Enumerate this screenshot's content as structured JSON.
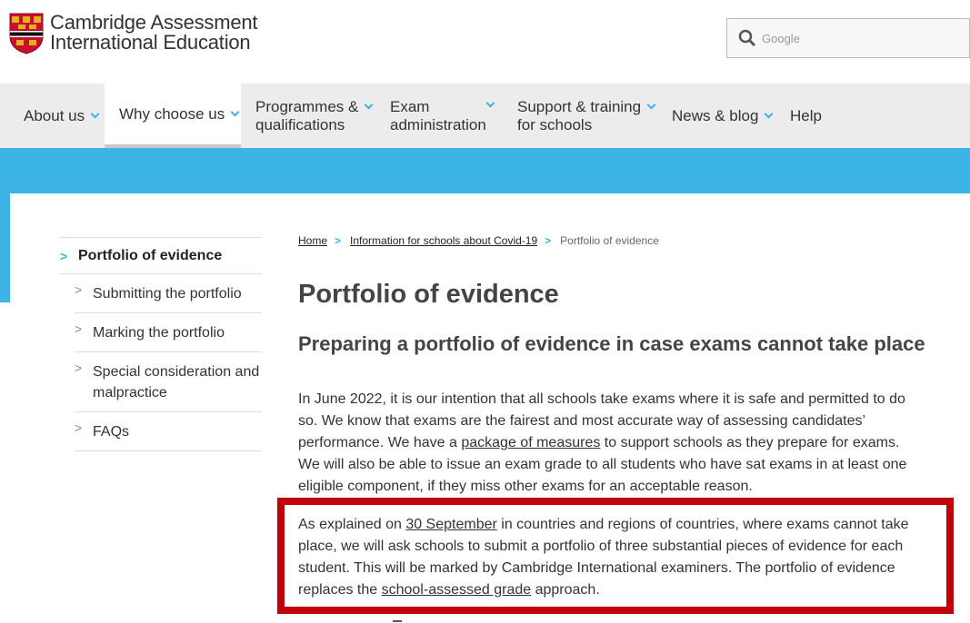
{
  "header": {
    "logo_line1": "Cambridge Assessment",
    "logo_line2": "International Education",
    "search_placeholder": "Google"
  },
  "nav": {
    "items": [
      {
        "label": "About us"
      },
      {
        "label": "Why choose us"
      },
      {
        "label_line1": "Programmes &",
        "label_line2": "qualifications"
      },
      {
        "label_line1": "Exam",
        "label_line2": "administration"
      },
      {
        "label_line1": "Support & training",
        "label_line2": "for schools"
      },
      {
        "label": "News & blog"
      },
      {
        "label": "Help"
      }
    ]
  },
  "sidebar": {
    "title": "Portfolio of evidence",
    "items": [
      {
        "label": "Submitting the portfolio"
      },
      {
        "label": "Marking the portfolio"
      },
      {
        "label": "Special consideration and malpractice"
      },
      {
        "label": "FAQs"
      }
    ]
  },
  "breadcrumb": {
    "home": "Home",
    "covid": "Information for schools about Covid-19",
    "current": "Portfolio of evidence"
  },
  "main": {
    "title": "Portfolio of evidence",
    "subtitle": "Preparing a portfolio of evidence in case exams cannot take place",
    "p1_a": "In June 2022, it is our intention that all schools take exams where it is safe and permitted to do so. We know that exams are the fairest and most accurate way of assessing candidates’ performance. We have a ",
    "p1_link": "package of measures",
    "p1_b": " to support schools as they prepare for exams. We will also be able to issue an exam grade to all students who have sat exams in at least one eligible component, if they miss other exams for an acceptable reason.",
    "p2_a": "As explained on ",
    "p2_link1": "30 September",
    "p2_b": " in countries and regions of countries, where exams cannot take place, we will ask schools to submit a portfolio of three substantial pieces of evidence for each student. This will be marked by Cambridge International examiners. The portfolio of evidence replaces the ",
    "p2_link2": "school-assessed grade",
    "p2_c": " approach."
  },
  "colors": {
    "accent_blue": "#3cb4e6",
    "highlight_red": "#c0000b",
    "nav_bg": "#ececec"
  }
}
